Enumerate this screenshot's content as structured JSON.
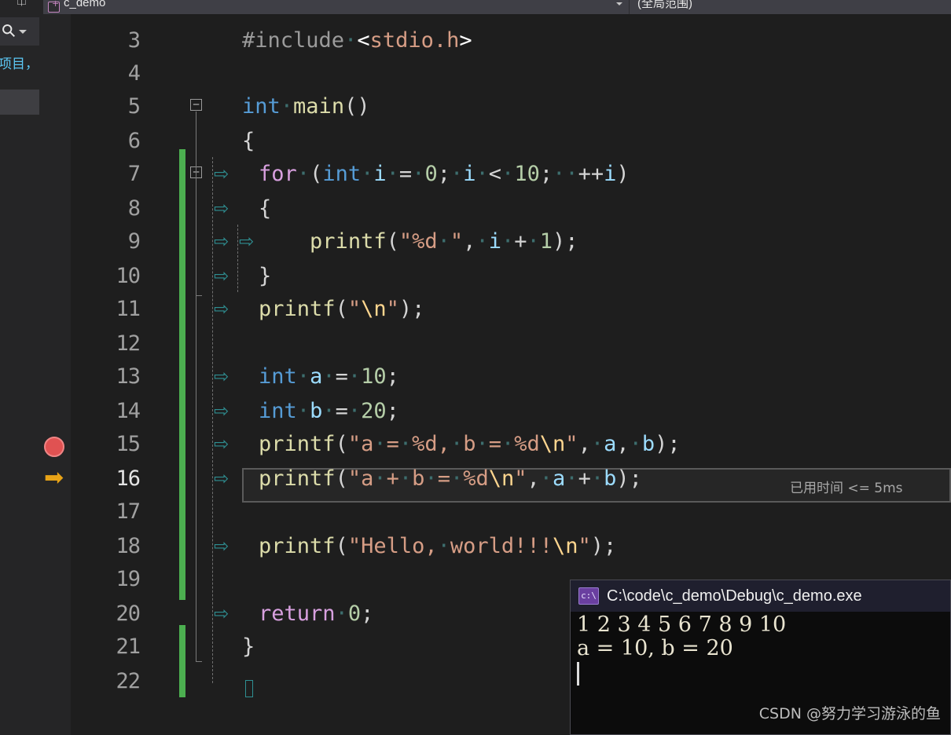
{
  "toolbar": {
    "type_combo": "c_demo",
    "member_combo": "(全局范围)",
    "type_icon": "cs-file-icon",
    "caret_icon": "chevron-down-icon"
  },
  "solution_explorer": {
    "dock_icon": "window-dock-icon",
    "search_icon": "key-search-icon",
    "search_caret_icon": "chevron-down-icon",
    "partial_text": "项目，"
  },
  "editor": {
    "first_visible_line": 3,
    "current_line": 16,
    "breakpoint_line": 15,
    "elapsed_annotation": "已用时间 <= 5ms",
    "breakpoint_icon": "breakpoint-icon",
    "exec_pointer_icon": "execution-pointer-icon",
    "lines": [
      {
        "n": 3,
        "text": "#include <stdio.h>"
      },
      {
        "n": 4,
        "text": ""
      },
      {
        "n": 5,
        "text": "int main()"
      },
      {
        "n": 6,
        "text": "{"
      },
      {
        "n": 7,
        "text": "    for (int i = 0; i < 10; ++i)"
      },
      {
        "n": 8,
        "text": "    {"
      },
      {
        "n": 9,
        "text": "        printf(\"%d \", i + 1);"
      },
      {
        "n": 10,
        "text": "    }"
      },
      {
        "n": 11,
        "text": "    printf(\"\\n\");"
      },
      {
        "n": 12,
        "text": ""
      },
      {
        "n": 13,
        "text": "    int a = 10;"
      },
      {
        "n": 14,
        "text": "    int b = 20;"
      },
      {
        "n": 15,
        "text": "    printf(\"a = %d, b = %d\\n\", a, b);"
      },
      {
        "n": 16,
        "text": "    printf(\"a + b = %d\\n\", a + b);"
      },
      {
        "n": 17,
        "text": ""
      },
      {
        "n": 18,
        "text": "    printf(\"Hello, world!!!\\n\");"
      },
      {
        "n": 19,
        "text": ""
      },
      {
        "n": 20,
        "text": "    return 0;"
      },
      {
        "n": 21,
        "text": "}"
      },
      {
        "n": 22,
        "text": ""
      }
    ]
  },
  "console": {
    "title": "C:\\code\\c_demo\\Debug\\c_demo.exe",
    "icon": "terminal-icon",
    "output": [
      "1 2 3 4 5 6 7 8 9 10",
      "a = 10, b = 20"
    ],
    "watermark": "CSDN @努力学习游泳的鱼"
  },
  "colors": {
    "editor_background": "#1e1e1e",
    "gutter_background": "#252526",
    "toolbar_background": "#3f3f46",
    "change_bar": "#4caf50",
    "breakpoint": "#e05252",
    "exec_arrow": "#e8a317",
    "console_background": "#0c0c0c",
    "console_title_background": "#1f1f2e",
    "keyword": "#569cd6",
    "control_keyword": "#d8a0df",
    "function": "#dcdcaa",
    "variable": "#9cdcfe",
    "number": "#b5cea8",
    "string": "#d69d85",
    "escape": "#ffd68f",
    "preprocessor": "#9b9b9b",
    "line_number": "#a0a0a0"
  }
}
